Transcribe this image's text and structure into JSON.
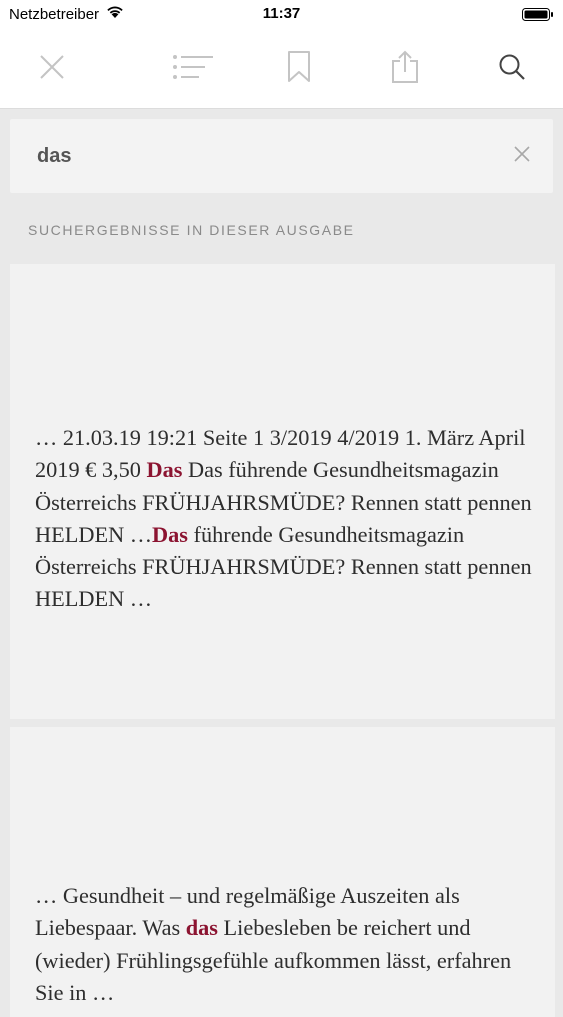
{
  "status_bar": {
    "carrier": "Netzbetreiber",
    "time": "11:37"
  },
  "toolbar": {
    "icons": [
      "close-icon",
      "toc-list-icon",
      "bookmark-icon",
      "share-icon",
      "search-icon"
    ]
  },
  "search": {
    "query": "das"
  },
  "results": {
    "section_label": "SUCHERGEBNISSE IN DIESER AUSGABE",
    "items": [
      {
        "seg0": "… 21.03.19 19:21 Seite 1 3/2019 4/2019 1. März April 2019 € 3,50 ",
        "hl0": "Das",
        "seg1": " Das führende Gesundheitsmagazin Österreichs FRÜHJAHRSMÜDE? Rennen statt pennen HELDEN …",
        "hl1": "Das",
        "seg2": " führende Gesundheitsmagazin Österreichs FRÜHJAHRSMÜDE? Rennen statt pennen HELDEN …"
      },
      {
        "seg0": "… Gesundheit – und regelmäßige Auszeiten als Liebespaar. Was ",
        "hl0": "das",
        "seg1": " Liebesleben be reichert und (wieder) Frühlingsgefühle aufkommen lässt, erfahren Sie in …"
      }
    ]
  },
  "colors": {
    "highlight": "#8c1431",
    "icon_gray": "#c4c4c4"
  }
}
